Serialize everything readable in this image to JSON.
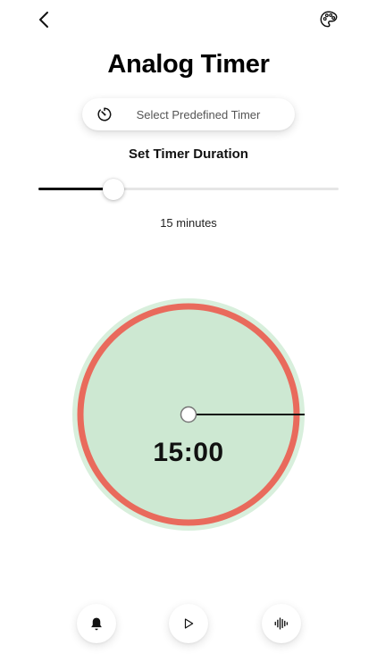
{
  "header": {
    "back_icon": "chevron-left-icon",
    "palette_icon": "palette-icon"
  },
  "title": "Analog Timer",
  "predefined_timer": {
    "icon": "timer-icon",
    "label": "Select Predefined Timer"
  },
  "duration": {
    "heading": "Set Timer Duration",
    "slider_fraction": 0.25,
    "value_label": "15 minutes"
  },
  "clock": {
    "display_time": "15:00",
    "ring_color": "#e96a5c",
    "face_color": "#cde8d2",
    "outer_glow_color": "#d8efdc",
    "remaining_fraction": 0.25
  },
  "controls": {
    "bell_icon": "bell-icon",
    "play_icon": "play-icon",
    "sound_icon": "sound-wave-icon"
  }
}
